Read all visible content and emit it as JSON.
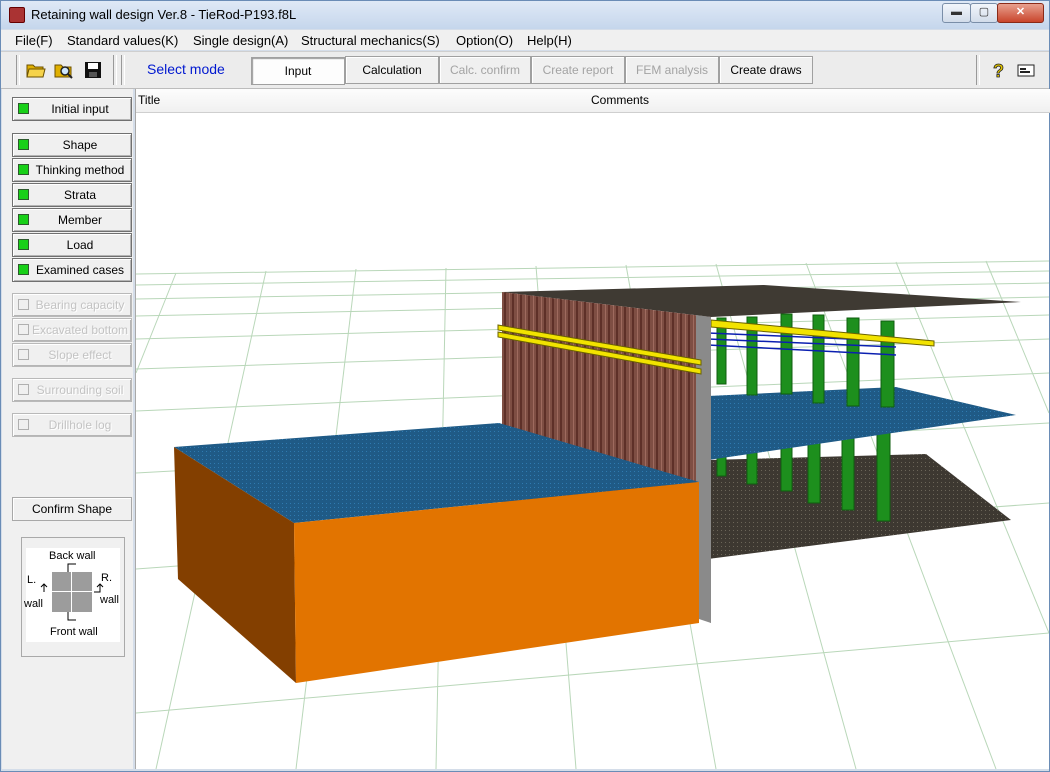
{
  "window": {
    "title": "Retaining wall design Ver.8 - TieRod-P193.f8L",
    "controls": {
      "minimize": "▬",
      "maximize": "▢",
      "close": "✕"
    }
  },
  "menu": [
    {
      "label": "File(F)"
    },
    {
      "label": "Standard values(K)"
    },
    {
      "label": "Single design(A)"
    },
    {
      "label": "Structural mechanics(S)"
    },
    {
      "label": "Option(O)"
    },
    {
      "label": "Help(H)"
    }
  ],
  "toolbar": {
    "icons": [
      "open-folder-icon",
      "search-folder-icon",
      "save-icon",
      "help-icon",
      "settings-icon"
    ],
    "select_mode_label": "Select mode",
    "modes": [
      {
        "label": "Input",
        "state": "active"
      },
      {
        "label": "Calculation",
        "state": "enabled"
      },
      {
        "label": "Calc. confirm",
        "state": "disabled"
      },
      {
        "label": "Create report",
        "state": "disabled"
      },
      {
        "label": "FEM analysis",
        "state": "disabled"
      },
      {
        "label": "Create draws",
        "state": "enabled"
      }
    ]
  },
  "sidebar": {
    "items": [
      {
        "label": "Initial input",
        "enabled": true
      },
      {
        "label": "Shape",
        "enabled": true
      },
      {
        "label": "Thinking method",
        "enabled": true
      },
      {
        "label": "Strata",
        "enabled": true
      },
      {
        "label": "Member",
        "enabled": true
      },
      {
        "label": "Load",
        "enabled": true
      },
      {
        "label": "Examined cases",
        "enabled": true
      },
      {
        "label": "Bearing capacity",
        "enabled": false
      },
      {
        "label": "Excavated bottom",
        "enabled": false
      },
      {
        "label": "Slope effect",
        "enabled": false
      },
      {
        "label": "Surrounding soil",
        "enabled": false
      },
      {
        "label": "Drillhole log",
        "enabled": false
      }
    ],
    "confirm_shape_label": "Confirm Shape",
    "diagram": {
      "back_wall": "Back wall",
      "front_wall": "Front wall",
      "left_wall_line1": "L.",
      "left_wall_line2": "wall",
      "right_wall_line1": "R.",
      "right_wall_line2": "wall"
    }
  },
  "table": {
    "columns": [
      {
        "label": "Title"
      },
      {
        "label": "Comments"
      }
    ]
  },
  "colors": {
    "lamp_on": "#18d018",
    "select_mode_text": "#0018d0",
    "excavation_front": "#e27400",
    "excavation_side": "#833f00",
    "water_surface": "#1f5a86",
    "sheet_pile": "#7a4b40",
    "tie_rod": "#f2e300",
    "anchor_pile": "#1d8f1d",
    "ground_surface": "#3f3a33"
  }
}
